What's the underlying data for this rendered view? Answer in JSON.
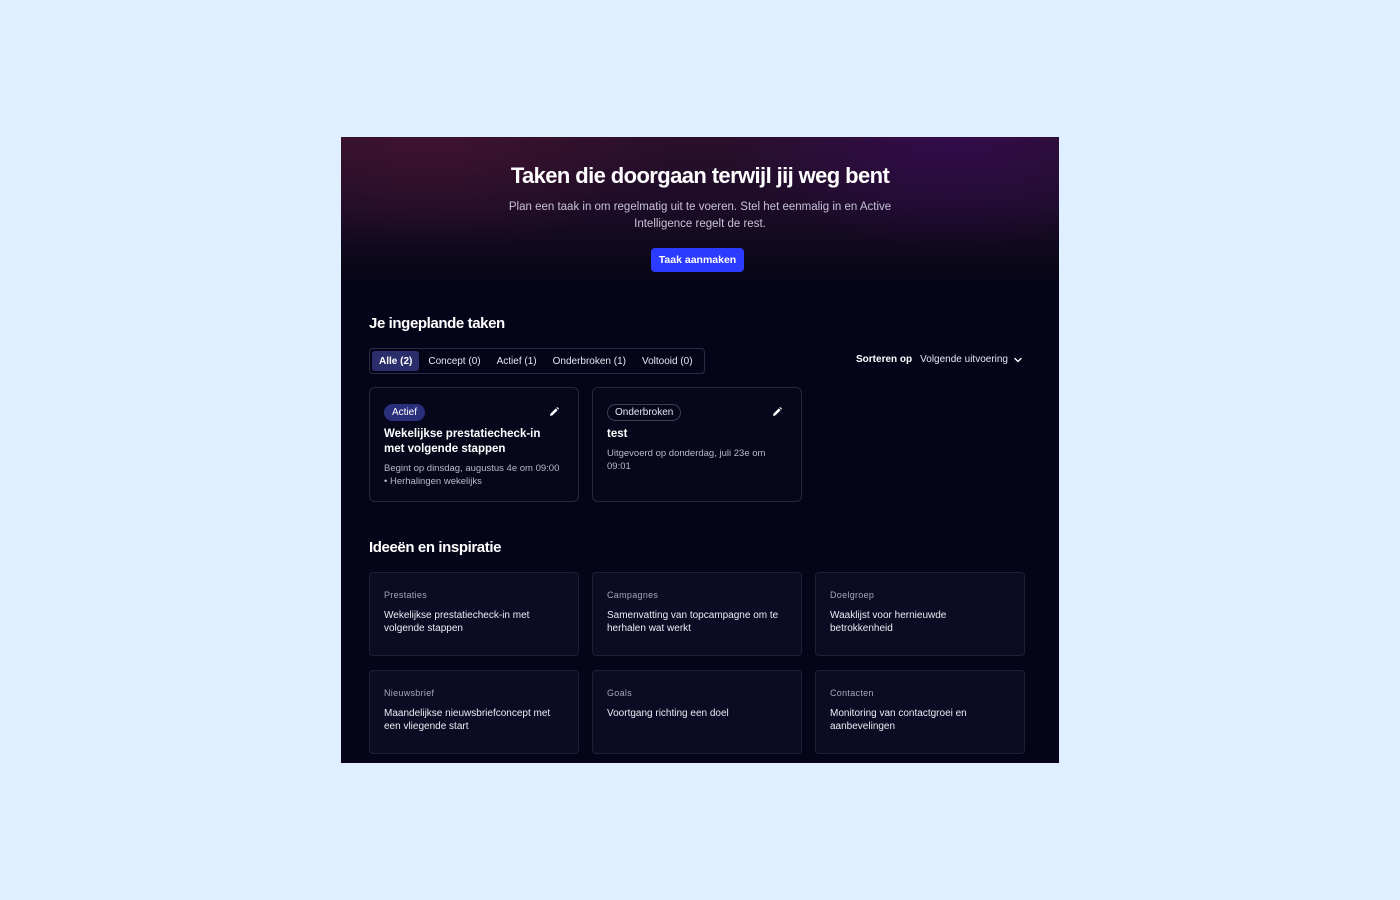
{
  "hero": {
    "title": "Taken die doorgaan terwijl jij weg bent",
    "subtitle": "Plan een taak in om regelmatig uit te voeren. Stel het eenmalig in en Active Intelligence regelt de rest.",
    "cta_label": "Taak aanmaken"
  },
  "scheduled": {
    "title": "Je ingeplande taken",
    "tabs": [
      {
        "label": "Alle (2)"
      },
      {
        "label": "Concept (0)"
      },
      {
        "label": "Actief (1)"
      },
      {
        "label": "Onderbroken (1)"
      },
      {
        "label": "Voltooid (0)"
      }
    ],
    "sort_label": "Sorteren op",
    "sort_value": "Volgende uitvoering",
    "tasks": [
      {
        "status": "Actief",
        "title": "Wekelijkse prestatiecheck-in met volgende stappen",
        "meta": "Begint op dinsdag, augustus 4e om 09:00 • Herhalingen wekelijks"
      },
      {
        "status": "Onderbroken",
        "title": "test",
        "meta": "Uitgevoerd op donderdag, juli 23e om 09:01"
      }
    ]
  },
  "ideas": {
    "title": "Ideeën en inspiratie",
    "items": [
      {
        "category": "Prestaties",
        "text": "Wekelijkse prestatiecheck-in met volgende stappen"
      },
      {
        "category": "Campagnes",
        "text": "Samenvatting van topcampagne om te herhalen wat werkt"
      },
      {
        "category": "Doelgroep",
        "text": "Waaklijst voor hernieuwde betrokkenheid"
      },
      {
        "category": "Nieuwsbrief",
        "text": "Maandelijkse nieuwsbriefconcept met een vliegende start"
      },
      {
        "category": "Goals",
        "text": "Voortgang richting een doel"
      },
      {
        "category": "Contacten",
        "text": "Monitoring van contactgroei en aanbevelingen"
      }
    ]
  },
  "colors": {
    "page_bg": "#dfefff",
    "app_bg": "#05051a",
    "primary": "#2b3bff",
    "badge_active": "#2a2f7c"
  },
  "icons": {
    "edit": "pencil-icon",
    "sort": "chevron-down-icon"
  }
}
